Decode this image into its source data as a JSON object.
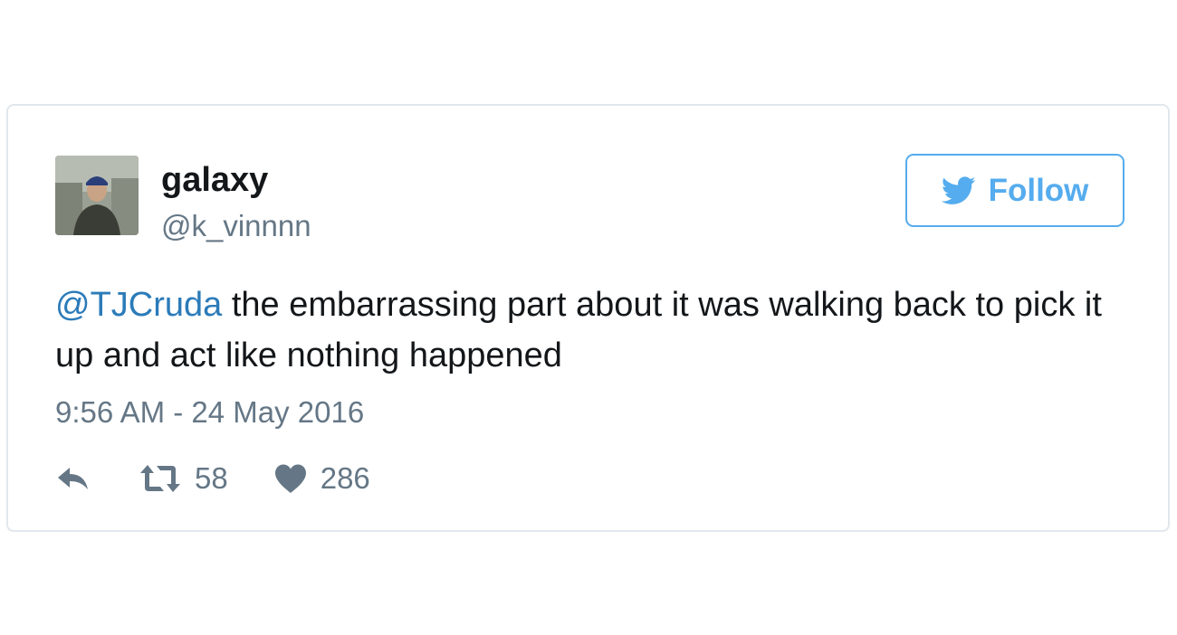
{
  "tweet": {
    "user": {
      "display_name": "galaxy",
      "handle": "@k_vinnnn",
      "avatar_icon": "user-photo"
    },
    "follow_button": {
      "label": "Follow",
      "icon": "twitter-bird-icon"
    },
    "text": {
      "mention": "@TJCruda",
      "body": " the embarrassing part about it was walking back to pick it up and act like nothing happened"
    },
    "timestamp": "9:56 AM - 24 May 2016",
    "actions": {
      "reply_icon": "reply-icon",
      "retweet_icon": "retweet-icon",
      "retweet_count": "58",
      "like_icon": "heart-icon",
      "like_count": "286"
    },
    "colors": {
      "accent": "#55acee",
      "link": "#2b7bb9",
      "text": "#14171a",
      "muted": "#657786",
      "border": "#e1e8ed"
    }
  }
}
